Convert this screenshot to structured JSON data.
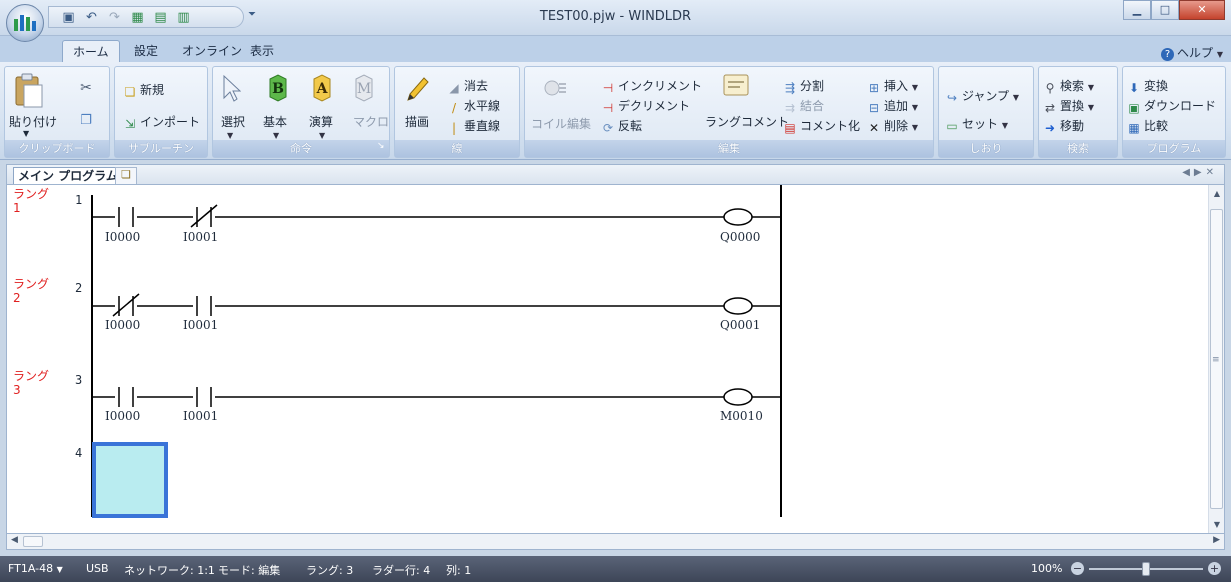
{
  "window": {
    "title": "TEST00.pjw - WINDLDR"
  },
  "qat_icons": [
    "save-icon",
    "undo-icon",
    "redo-icon",
    "monitor-icon",
    "download-icon",
    "upload-icon"
  ],
  "tabs": [
    {
      "label": "ホーム",
      "active": true
    },
    {
      "label": "設定",
      "active": false
    },
    {
      "label": "オンライン",
      "active": false
    },
    {
      "label": "表示",
      "active": false
    }
  ],
  "help_label": "ヘルプ",
  "ribbon": {
    "clipboard": {
      "label": "クリップボード",
      "paste": "貼り付け"
    },
    "subroutine": {
      "label": "サブルーチン",
      "new": "新規",
      "import": "インポート"
    },
    "instruction": {
      "label": "命令",
      "select": "選択",
      "basic": "基本",
      "calc": "演算",
      "macro": "マクロ",
      "basic_glyph": "B",
      "calc_glyph": "A",
      "macro_glyph": "M"
    },
    "line": {
      "label": "線",
      "draw": "描画",
      "erase": "消去",
      "horizontal": "水平線",
      "vertical": "垂直線"
    },
    "edit": {
      "label": "編集",
      "coil_edit": "コイル編集",
      "increment": "インクリメント",
      "decrement": "デクリメント",
      "invert": "反転",
      "rung_comment": "ラングコメント",
      "split": "分割",
      "merge": "結合",
      "commentize": "コメント化",
      "insert": "挿入",
      "add": "追加",
      "delete": "削除"
    },
    "bookmark": {
      "label": "しおり",
      "jump": "ジャンプ",
      "set": "セット"
    },
    "search": {
      "label": "検索",
      "find": "検索",
      "replace": "置換",
      "move": "移動"
    },
    "program": {
      "label": "プログラム",
      "convert": "変換",
      "download": "ダウンロード",
      "compare": "比較"
    }
  },
  "document_tab": {
    "label": "メイン プログラム"
  },
  "ladder": {
    "rungs": [
      {
        "label": "ラング",
        "number": "1",
        "index": "1",
        "contacts": [
          {
            "device": "I0000",
            "type": "NO"
          },
          {
            "device": "I0001",
            "type": "NC"
          }
        ],
        "coil": "Q0000"
      },
      {
        "label": "ラング",
        "number": "2",
        "index": "2",
        "contacts": [
          {
            "device": "I0000",
            "type": "NC"
          },
          {
            "device": "I0001",
            "type": "NO"
          }
        ],
        "coil": "Q0001"
      },
      {
        "label": "ラング",
        "number": "3",
        "index": "3",
        "contacts": [
          {
            "device": "I0000",
            "type": "NO"
          },
          {
            "device": "I0001",
            "type": "NO"
          }
        ],
        "coil": "M0010"
      }
    ],
    "empty_row_index": "4"
  },
  "status": {
    "model": "FT1A-48",
    "connection": "USB",
    "network": "ネットワーク: 1:1",
    "mode": "モード: 編集",
    "rung": "ラング: 3",
    "ladder_row": "ラダー行: 4",
    "column": "列: 1",
    "zoom": "100%",
    "zoom_level_percent": 100
  },
  "colors": {
    "rung_label": "#e02020",
    "cursor_fill": "#b9ecf0",
    "cursor_border": "#3a74d8"
  }
}
